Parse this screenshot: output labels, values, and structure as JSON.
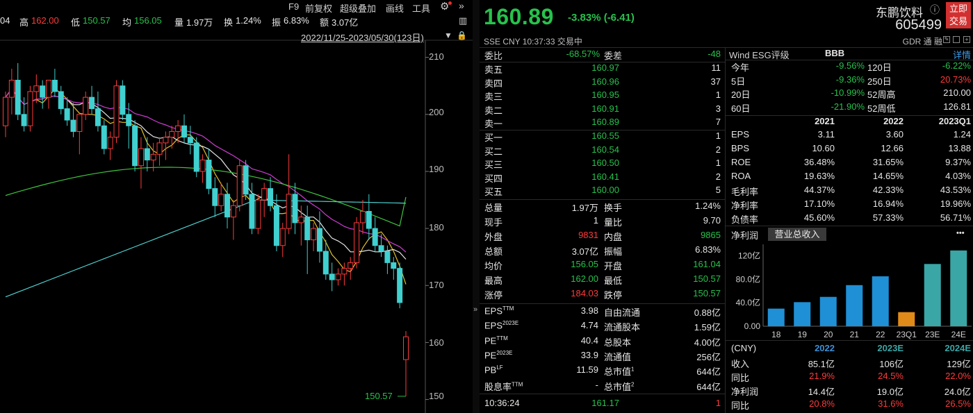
{
  "toolbar": {
    "items": [
      "F9",
      "前复权",
      "超级叠加",
      "画线",
      "工具"
    ],
    "range": "2022/11/25-2023/05/30(123日)"
  },
  "ohlc": {
    "open_frag": "04",
    "high_label": "高",
    "high": "162.00",
    "low_label": "低",
    "low": "150.57",
    "avg_label": "均",
    "avg": "156.05",
    "vol_label": "量",
    "vol": "1.97万",
    "turn_label": "换",
    "turn": "1.24%",
    "amp_label": "振",
    "amp": "6.83%",
    "amt_label": "额",
    "amt": "3.07亿"
  },
  "chart_data": {
    "type": "candlestick",
    "y_ticks": [
      "210",
      "200",
      "190",
      "180",
      "170",
      "160",
      "150"
    ],
    "ylim": [
      148,
      213
    ],
    "last_low_label": "150.57",
    "candles": [
      [
        198,
        204,
        196,
        203
      ],
      [
        203,
        208,
        200,
        206
      ],
      [
        206,
        209,
        199,
        200
      ],
      [
        200,
        203,
        197,
        198
      ],
      [
        198,
        205,
        197,
        204
      ],
      [
        204,
        207,
        202,
        205
      ],
      [
        205,
        206,
        201,
        203
      ],
      [
        203,
        206,
        201,
        206
      ],
      [
        206,
        208,
        203,
        204
      ],
      [
        204,
        205,
        200,
        201
      ],
      [
        201,
        203,
        198,
        199
      ],
      [
        199,
        202,
        196,
        197
      ],
      [
        197,
        200,
        193,
        200
      ],
      [
        200,
        204,
        199,
        203
      ],
      [
        203,
        205,
        200,
        201
      ],
      [
        201,
        204,
        197,
        198
      ],
      [
        198,
        199,
        193,
        194
      ],
      [
        194,
        197,
        192,
        196
      ],
      [
        196,
        206,
        195,
        205
      ],
      [
        205,
        206,
        199,
        200
      ],
      [
        200,
        202,
        194,
        198
      ],
      [
        198,
        199,
        190,
        191
      ],
      [
        191,
        196,
        187,
        194
      ],
      [
        194,
        196,
        190,
        192
      ],
      [
        192,
        195,
        190,
        193
      ],
      [
        193,
        196,
        191,
        195
      ],
      [
        195,
        197,
        192,
        196
      ],
      [
        196,
        198,
        194,
        197
      ],
      [
        197,
        199,
        195,
        198
      ],
      [
        198,
        200,
        195,
        196
      ],
      [
        196,
        198,
        193,
        195
      ],
      [
        195,
        196,
        189,
        190
      ],
      [
        190,
        193,
        188,
        192
      ],
      [
        192,
        194,
        186,
        187
      ],
      [
        187,
        189,
        182,
        184
      ],
      [
        184,
        188,
        183,
        186
      ],
      [
        186,
        188,
        180,
        182
      ],
      [
        182,
        185,
        178,
        184
      ],
      [
        184,
        192,
        183,
        191
      ],
      [
        191,
        192,
        185,
        186
      ],
      [
        186,
        188,
        179,
        180
      ],
      [
        180,
        186,
        179,
        185
      ],
      [
        185,
        188,
        182,
        187
      ],
      [
        187,
        189,
        183,
        184
      ],
      [
        184,
        186,
        176,
        177
      ],
      [
        177,
        181,
        175,
        180
      ],
      [
        180,
        193,
        179,
        186
      ],
      [
        186,
        188,
        179,
        181
      ],
      [
        181,
        184,
        177,
        182
      ],
      [
        182,
        184,
        172,
        178
      ],
      [
        178,
        181,
        176,
        180
      ],
      [
        180,
        183,
        174,
        176
      ],
      [
        176,
        178,
        171,
        172
      ],
      [
        172,
        174,
        169,
        171
      ],
      [
        171,
        173,
        170,
        172
      ],
      [
        172,
        174,
        170,
        173
      ],
      [
        173,
        175,
        171,
        174
      ],
      [
        174,
        182,
        173,
        181
      ],
      [
        181,
        185,
        179,
        183
      ],
      [
        183,
        186,
        178,
        180
      ],
      [
        180,
        182,
        176,
        177
      ],
      [
        177,
        179,
        175,
        176
      ],
      [
        176,
        177,
        172,
        174
      ],
      [
        174,
        175,
        171,
        173
      ],
      [
        173,
        174,
        166,
        167
      ],
      [
        157,
        162,
        150.57,
        161
      ]
    ]
  },
  "quote": {
    "price": "160.89",
    "change": "-3.83% (-6.41)",
    "meta": "SSE  CNY  10:37:33  交易中",
    "name": "东鹏饮料",
    "code": "605499",
    "trade_btn": [
      "立即",
      "交易"
    ],
    "gdr_line": "GDR  通  融"
  },
  "order_book": {
    "wb_label": "委比",
    "wb": "-68.57%",
    "wc_label": "委差",
    "wc": "-48",
    "asks": [
      {
        "label": "卖五",
        "price": "160.97",
        "vol": "11"
      },
      {
        "label": "卖四",
        "price": "160.96",
        "vol": "37"
      },
      {
        "label": "卖三",
        "price": "160.95",
        "vol": "1"
      },
      {
        "label": "卖二",
        "price": "160.91",
        "vol": "3"
      },
      {
        "label": "卖一",
        "price": "160.89",
        "vol": "7"
      }
    ],
    "bids": [
      {
        "label": "买一",
        "price": "160.55",
        "vol": "1"
      },
      {
        "label": "买二",
        "price": "160.54",
        "vol": "2"
      },
      {
        "label": "买三",
        "price": "160.50",
        "vol": "1"
      },
      {
        "label": "买四",
        "price": "160.41",
        "vol": "2"
      },
      {
        "label": "买五",
        "price": "160.00",
        "vol": "5"
      }
    ]
  },
  "stats": [
    {
      "l1": "总量",
      "v1": "1.97万",
      "l2": "换手",
      "v2": "1.24%"
    },
    {
      "l1": "现手",
      "v1": "1",
      "l2": "量比",
      "v2": "9.70"
    },
    {
      "l1": "外盘",
      "v1": "9831",
      "l2": "内盘",
      "v2": "9865"
    },
    {
      "l1": "总额",
      "v1": "3.07亿",
      "l2": "振幅",
      "v2": "6.83%"
    },
    {
      "l1": "均价",
      "v1": "156.05",
      "l2": "开盘",
      "v2": "161.04"
    },
    {
      "l1": "最高",
      "v1": "162.00",
      "l2": "最低",
      "v2": "150.57"
    },
    {
      "l1": "涨停",
      "v1": "184.03",
      "l2": "跌停",
      "v2": "150.57"
    }
  ],
  "valuation": [
    {
      "l1": "EPS",
      "s1": "TTM",
      "v1": "3.98",
      "l2": "自由流通",
      "v2": "0.88亿"
    },
    {
      "l1": "EPS",
      "s1": "2023E",
      "v1": "4.74",
      "l2": "流通股本",
      "v2": "1.59亿"
    },
    {
      "l1": "PE",
      "s1": "TTM",
      "v1": "40.4",
      "l2": "总股本",
      "v2": "4.00亿"
    },
    {
      "l1": "PE",
      "s1": "2023E",
      "v1": "33.9",
      "l2": "流通值",
      "v2": "256亿"
    },
    {
      "l1": "PB",
      "s1": "LF",
      "v1": "11.59",
      "l2": "总市值",
      "s2": "1",
      "v2": "644亿"
    },
    {
      "l1": "股息率",
      "s1": "TTM",
      "v1": "-",
      "l2": "总市值",
      "s2": "2",
      "v2": "644亿"
    }
  ],
  "last_trade": {
    "time": "10:36:24",
    "price": "161.17",
    "vol": "1"
  },
  "esg": {
    "label": "Wind ESG评级",
    "rating": "BBB",
    "detail": "详情"
  },
  "returns": [
    {
      "l1": "今年",
      "v1": "-9.56%",
      "l2": "120日",
      "v2": "-6.22%"
    },
    {
      "l1": "5日",
      "v1": "-9.36%",
      "l2": "250日",
      "v2": "20.73%"
    },
    {
      "l1": "20日",
      "v1": "-10.99%",
      "l2": "52周高",
      "v2": "210.00"
    },
    {
      "l1": "60日",
      "v1": "-21.90%",
      "l2": "52周低",
      "v2": "126.81"
    }
  ],
  "fin_headers": [
    "2021",
    "2022",
    "2023Q1"
  ],
  "financials": [
    {
      "label": "EPS",
      "vals": [
        "3.11",
        "3.60",
        "1.24"
      ]
    },
    {
      "label": "BPS",
      "vals": [
        "10.60",
        "12.66",
        "13.88"
      ]
    },
    {
      "label": "ROE",
      "vals": [
        "36.48%",
        "31.65%",
        "9.37%"
      ]
    },
    {
      "label": "ROA",
      "vals": [
        "19.63%",
        "14.65%",
        "4.03%"
      ]
    },
    {
      "label": "毛利率",
      "vals": [
        "44.37%",
        "42.33%",
        "43.53%"
      ]
    },
    {
      "label": "净利率",
      "vals": [
        "17.10%",
        "16.94%",
        "19.96%"
      ]
    },
    {
      "label": "负债率",
      "vals": [
        "45.60%",
        "57.33%",
        "56.71%"
      ]
    }
  ],
  "revenue_chart": {
    "tab_inactive": "净利润",
    "tab_active": "营业总收入",
    "more": "•••",
    "y_ticks": [
      "120亿",
      "80.0亿",
      "40.0亿",
      "0.00"
    ],
    "categories": [
      "18",
      "19",
      "20",
      "21",
      "22",
      "23Q1",
      "23E",
      "24E"
    ],
    "values": [
      30,
      41,
      50,
      70,
      85,
      24,
      106,
      129
    ],
    "ylim": [
      0,
      130
    ]
  },
  "forecast": {
    "unit": "(CNY)",
    "headers": [
      "2022",
      "2023E",
      "2024E"
    ],
    "rows": [
      {
        "label": "收入",
        "vals": [
          "85.1亿",
          "106亿",
          "129亿"
        ]
      },
      {
        "label": "同比",
        "vals": [
          "21.9%",
          "24.5%",
          "22.0%"
        ]
      },
      {
        "label": "净利润",
        "vals": [
          "14.4亿",
          "19.0亿",
          "24.0亿"
        ]
      },
      {
        "label": "同比",
        "vals": [
          "20.8%",
          "31.6%",
          "26.5%"
        ]
      }
    ]
  }
}
